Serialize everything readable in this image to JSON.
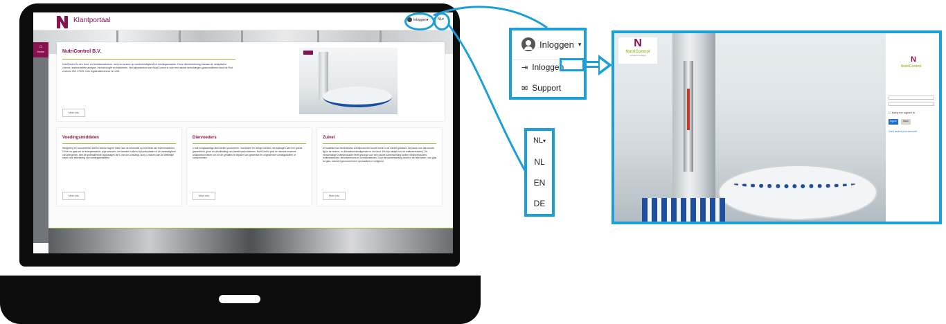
{
  "colors": {
    "brand": "#88114f",
    "accent_green": "#9fbf3a",
    "callout_blue": "#1a9fd8"
  },
  "site": {
    "title": "Klantportaal",
    "login_label": "Inloggen▾",
    "lang_label": "NL▾",
    "nav_home": "Home",
    "intro": {
      "title": "NutriControl B.V.",
      "text": "NutriControl is een food- en feedlaboratorium, met een accent op voedselveiligheid en voedingswaarde. Onze dienstverlening bestaat uit: analytische chemie, instrumentele analyse, microbiologie en biochemie. Het laboratorium van NutriControl is voor een aantal verrichtingen geaccrediteerd door de RvA conform ISO 17025. Ons registratienummer is L203.",
      "more": "Meer info"
    },
    "cards": [
      {
        "title": "Voedingsmiddelen",
        "text": "Wetgeving en consumenten stellen steeds hogere eisen aan de informatie op het etiket van levensmiddelen. Of het nu gaat om de energiewaarde, type vetzuren, het aandeel suikers bij koolhydraten of de aanwezigheid van allergenen. Met de gedetailleerde rapportages die u van ons ontvangt, kunt u voldoen aan de wettelijke eisen voor etikettering van voedingsmiddelen.",
        "more": "Meer info"
      },
      {
        "title": "Diervoeders",
        "text": "U wilt hoogwaardige diervoeders produceren. Voedzame en veilige voeders, die bijdragen aan een goede gezondheid, groei en ontwikkeling van (landbouw)huisdieren. NutriControl past de nieuwst moderne analysetechnieken toe om de gehaltes te bepalen van gewenste en ongewenste voedingsstoffen of componenten.",
        "more": "Meer info"
      },
      {
        "title": "Zuivel",
        "text": "De kwaliteit van Nederlandse zuivelproducten wordt overal in de wereld gewaard. De basis voor dat succes ligt in de bodem- en klimaatomstandigheden in ons land. Die zijn ideaal voor de melkveehouderij. De eeuwenlange zuivelproductie heeft gezorgd voor een nauwe samenwerking tussen melkveehouders, melkverwerkers, dienstverleners en kennisinstituten. Door die samenwerking wordt in de hele keten- van gras tot glas- intensief geconcentreerd op kwaliteit en veiligheid.",
        "more": "Meer info"
      }
    ]
  },
  "callouts": {
    "login_menu": {
      "header": "Inloggen",
      "items": [
        {
          "icon": "sign-in-icon",
          "label": "Inloggen"
        },
        {
          "icon": "envelope-icon",
          "label": "Support"
        }
      ]
    },
    "lang_menu": {
      "header": "NL",
      "options": [
        "NL",
        "EN",
        "DE"
      ]
    }
  },
  "login_page": {
    "brand_name": "NutriControl",
    "brand_tagline": "excellent analysis",
    "keep_signed_in": "Keep me signed in",
    "sign_in": "Sign in",
    "back": "Back",
    "forgot": "Can't access your account?"
  }
}
